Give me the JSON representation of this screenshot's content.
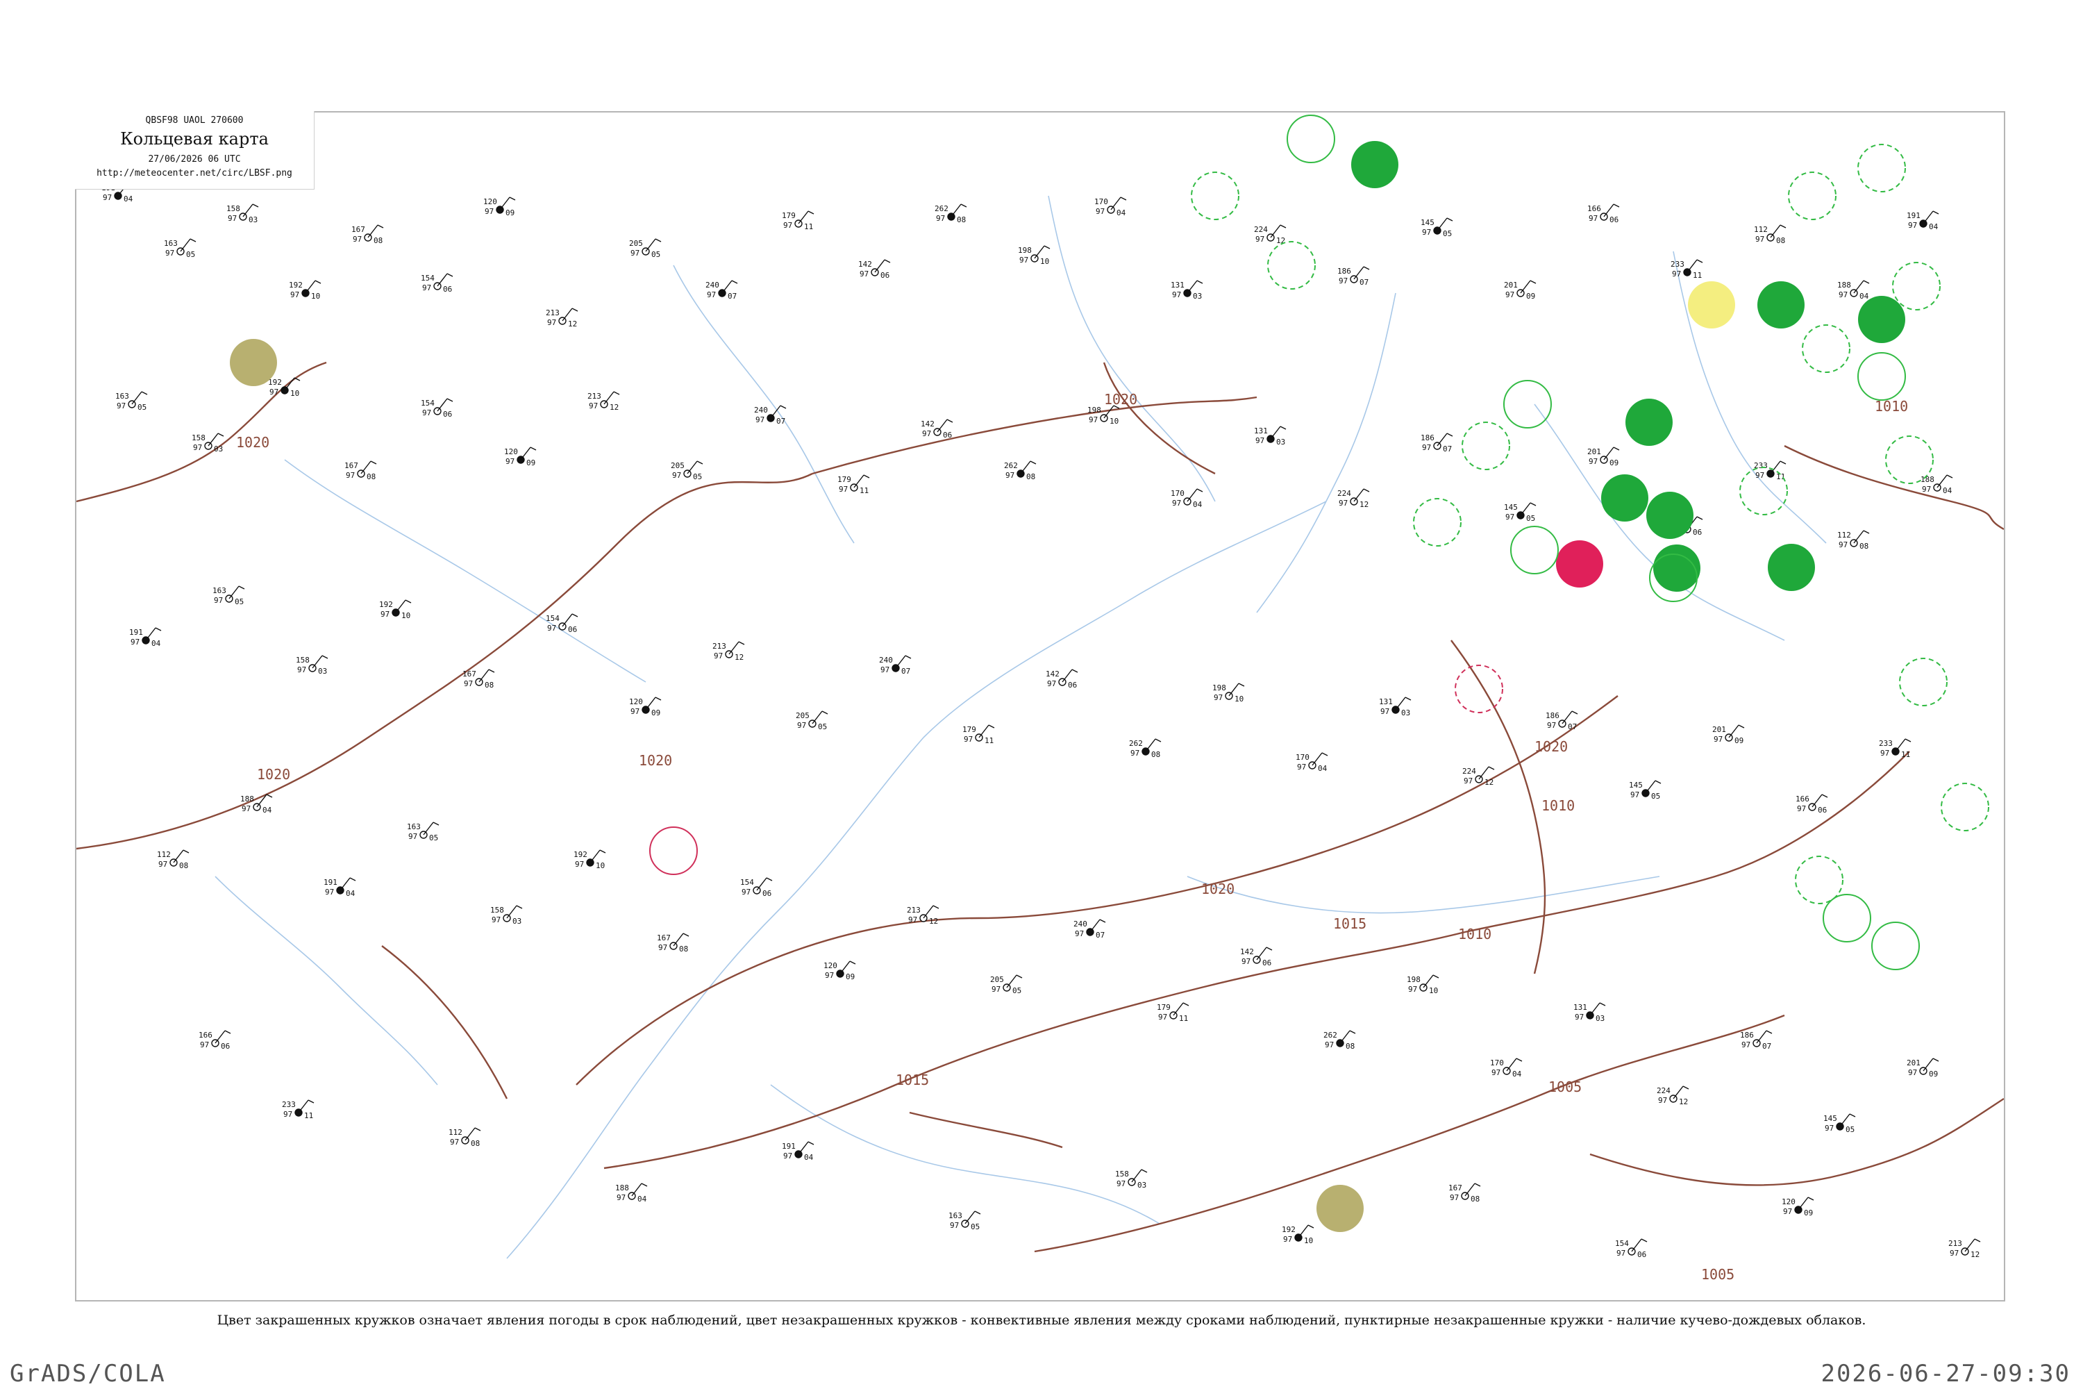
{
  "header": {
    "code_line": "QBSF98  UAOL  270600",
    "title": "Кольцевая карта",
    "date_line": "27/06/2026 06 UTC",
    "url": "http://meteocenter.net/circ/LBSF.png"
  },
  "caption": "Цвет закрашенных кружков означает явления погоды в срок наблюдений, цвет незакрашенных кружков - конвективные явления между сроками наблюдений, пунктирные незакрашенные кружки - наличие кучево-дождевых облаков.",
  "footer": {
    "left": "GrADS/COLA",
    "right": "2026-06-27-09:30"
  },
  "isobar_labels": [
    "1020",
    "1020",
    "1020",
    "1015",
    "1015",
    "1010",
    "1010",
    "1005",
    "1005",
    "1020",
    "1020",
    "1020",
    "1010"
  ],
  "colors": {
    "isobar": "#8a4a3a",
    "river": "#a8c8e8",
    "rain_fill": "#1fa83a",
    "storm_fill": "#e0205a",
    "fog_fill": "#b8b070",
    "drizzle_fill": "#f4ee80",
    "convective_ring": "#33bb44",
    "thunder_ring": "#d0305a"
  },
  "stations": [
    {
      "p": "191",
      "t": "97",
      "d": "04"
    },
    {
      "p": "163",
      "t": "97",
      "d": "05"
    },
    {
      "p": "158",
      "t": "97",
      "d": "03"
    },
    {
      "p": "192",
      "t": "97",
      "d": "10"
    },
    {
      "p": "167",
      "t": "97",
      "d": "08"
    },
    {
      "p": "154",
      "t": "97",
      "d": "06"
    },
    {
      "p": "120",
      "t": "97",
      "d": "09"
    },
    {
      "p": "213",
      "t": "97",
      "d": "12"
    },
    {
      "p": "205",
      "t": "97",
      "d": "05"
    },
    {
      "p": "240",
      "t": "97",
      "d": "07"
    },
    {
      "p": "179",
      "t": "97",
      "d": "11"
    },
    {
      "p": "142",
      "t": "97",
      "d": "06"
    },
    {
      "p": "262",
      "t": "97",
      "d": "08"
    },
    {
      "p": "198",
      "t": "97",
      "d": "10"
    },
    {
      "p": "170",
      "t": "97",
      "d": "04"
    },
    {
      "p": "131",
      "t": "97",
      "d": "03"
    },
    {
      "p": "224",
      "t": "97",
      "d": "12"
    },
    {
      "p": "186",
      "t": "97",
      "d": "07"
    },
    {
      "p": "145",
      "t": "97",
      "d": "05"
    },
    {
      "p": "201",
      "t": "97",
      "d": "09"
    },
    {
      "p": "166",
      "t": "97",
      "d": "06"
    },
    {
      "p": "233",
      "t": "97",
      "d": "11"
    },
    {
      "p": "112",
      "t": "97",
      "d": "08"
    },
    {
      "p": "188",
      "t": "97",
      "d": "04"
    }
  ]
}
